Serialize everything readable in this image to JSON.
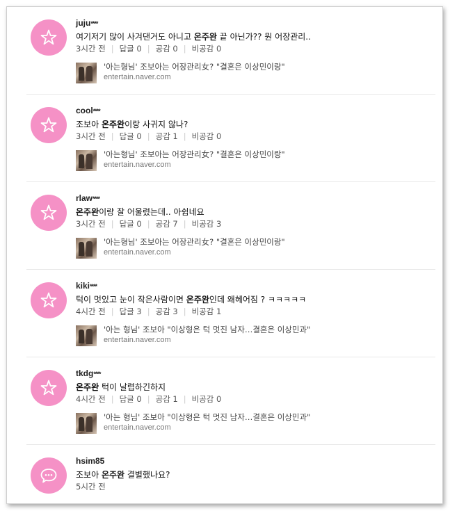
{
  "comments": [
    {
      "user": "juju",
      "user_mask": "****",
      "icon": "star-icon",
      "text_before": "여기저기 많이 사겨댄거도 아니고 ",
      "text_bold": "온주완",
      "text_after": " 끝 아닌가?? 뭔 어장관리..",
      "time": "3시간 전",
      "replies": "답글 0",
      "likes": "공감 0",
      "dislikes": "비공감 0",
      "link_title": "'아는형님' 조보아는 어장관리女? \"결혼은 이상민이랑\"",
      "link_domain": "entertain.naver.com"
    },
    {
      "user": "cool",
      "user_mask": "****",
      "icon": "star-icon",
      "text_before": "조보아 ",
      "text_bold": "온주완",
      "text_after": "이랑 사귀지 않나?",
      "time": "3시간 전",
      "replies": "답글 0",
      "likes": "공감 1",
      "dislikes": "비공감 0",
      "link_title": "'아는형님' 조보아는 어장관리女? \"결혼은 이상민이랑\"",
      "link_domain": "entertain.naver.com"
    },
    {
      "user": "rlaw",
      "user_mask": "****",
      "icon": "star-icon",
      "text_before": "",
      "text_bold": "온주완",
      "text_after": "이랑 잘 어울렸는데.. 아쉽네요",
      "time": "3시간 전",
      "replies": "답글 0",
      "likes": "공감 7",
      "dislikes": "비공감 3",
      "link_title": "'아는형님' 조보아는 어장관리女? \"결혼은 이상민이랑\"",
      "link_domain": "entertain.naver.com"
    },
    {
      "user": "kiki",
      "user_mask": "****",
      "icon": "star-icon",
      "text_before": "턱이 멋있고 눈이 작은사람이면 ",
      "text_bold": "온주완",
      "text_after": "인데 왜헤어짐 ? ㅋㅋㅋㅋㅋ",
      "time": "4시간 전",
      "replies": "답글 3",
      "likes": "공감 3",
      "dislikes": "비공감 1",
      "link_title": "'아는 형님' 조보아 \"이상형은 턱 멋진 남자…결혼은 이상민과\"",
      "link_domain": "entertain.naver.com"
    },
    {
      "user": "tkdg",
      "user_mask": "****",
      "icon": "star-icon",
      "text_before": "",
      "text_bold": "온주완",
      "text_after": " 턱이 날렵하긴하지",
      "time": "4시간 전",
      "replies": "답글 0",
      "likes": "공감 1",
      "dislikes": "비공감 0",
      "link_title": "'아는 형님' 조보아 \"이상형은 턱 멋진 남자…결혼은 이상민과\"",
      "link_domain": "entertain.naver.com"
    },
    {
      "user": "hsim85",
      "user_mask": "",
      "icon": "speech-bubble-icon",
      "text_before": "조보아 ",
      "text_bold": "온주완",
      "text_after": " 결별했나요?",
      "time": "5시간 전"
    }
  ],
  "colors": {
    "avatar_bg": "#f591c6"
  }
}
